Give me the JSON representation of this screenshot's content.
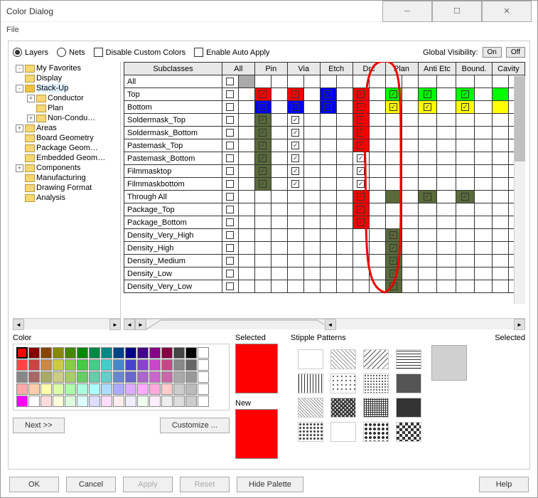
{
  "window": {
    "title": "Color Dialog"
  },
  "menu": {
    "file": "File"
  },
  "top": {
    "layers": "Layers",
    "nets": "Nets",
    "disable_custom": "Disable Custom Colors",
    "enable_auto": "Enable Auto Apply",
    "gv_label": "Global Visibility:",
    "on": "On",
    "off": "Off"
  },
  "tree": [
    {
      "ind": 0,
      "exp": "-",
      "label": "My Favorites"
    },
    {
      "ind": 0,
      "exp": "",
      "label": "Display"
    },
    {
      "ind": 0,
      "exp": "-",
      "label": "Stack-Up",
      "sel": true
    },
    {
      "ind": 1,
      "exp": "+",
      "label": "Conductor"
    },
    {
      "ind": 1,
      "exp": "",
      "label": "Plan"
    },
    {
      "ind": 1,
      "exp": "+",
      "label": "Non-Condu…"
    },
    {
      "ind": 0,
      "exp": "+",
      "label": "Areas"
    },
    {
      "ind": 0,
      "exp": "",
      "label": "Board Geometry"
    },
    {
      "ind": 0,
      "exp": "",
      "label": "Package Geom…"
    },
    {
      "ind": 0,
      "exp": "",
      "label": "Embedded Geom…"
    },
    {
      "ind": 0,
      "exp": "+",
      "label": "Components"
    },
    {
      "ind": 0,
      "exp": "",
      "label": "Manufacturing"
    },
    {
      "ind": 0,
      "exp": "",
      "label": "Drawing Format"
    },
    {
      "ind": 0,
      "exp": "",
      "label": "Analysis"
    }
  ],
  "cols": [
    "All",
    "Pin",
    "Via",
    "Etch",
    "Drc",
    "Plan",
    "Anti Etc",
    "Bound.",
    "Cavity"
  ],
  "subclass_hdr": "Subclasses",
  "rows": [
    {
      "name": "All",
      "cells": [
        [
          "cb",
          ""
        ],
        [
          "",
          "#aaa"
        ],
        [
          "",
          ""
        ],
        [
          "",
          ""
        ],
        [
          "",
          ""
        ],
        [
          "",
          ""
        ],
        [
          "",
          ""
        ],
        [
          "",
          ""
        ],
        [
          "",
          ""
        ],
        [
          "",
          ""
        ],
        [
          "",
          ""
        ],
        [
          "",
          ""
        ],
        [
          "",
          ""
        ],
        [
          "",
          ""
        ],
        [
          "",
          ""
        ],
        [
          "",
          ""
        ],
        [
          "",
          ""
        ],
        [
          "",
          ""
        ]
      ]
    },
    {
      "name": "Top",
      "cells": [
        [
          "cb",
          ""
        ],
        [
          "",
          ""
        ],
        [
          "cbc",
          "#f00"
        ],
        [
          "",
          ""
        ],
        [
          "cbc",
          "#f00"
        ],
        [
          "",
          ""
        ],
        [
          "cbc",
          "#00f"
        ],
        [
          "",
          ""
        ],
        [
          "cbc",
          "#f00"
        ],
        [
          "",
          ""
        ],
        [
          "cbc",
          "#0f0"
        ],
        [
          "",
          ""
        ],
        [
          "cbc",
          "#0f0"
        ],
        [
          "",
          ""
        ],
        [
          "cbc",
          "#0f0"
        ],
        [
          "",
          ""
        ],
        [
          "",
          "#0f0"
        ],
        [
          "",
          ""
        ]
      ]
    },
    {
      "name": "Bottom",
      "cells": [
        [
          "cb",
          ""
        ],
        [
          "",
          ""
        ],
        [
          "cbc",
          "#00f"
        ],
        [
          "",
          ""
        ],
        [
          "cbc",
          "#00f"
        ],
        [
          "",
          ""
        ],
        [
          "cbc",
          "#00f"
        ],
        [
          "",
          ""
        ],
        [
          "cbc",
          "#f00"
        ],
        [
          "",
          ""
        ],
        [
          "cbc",
          "#ff0"
        ],
        [
          "",
          ""
        ],
        [
          "cbc",
          "#ff0"
        ],
        [
          "",
          ""
        ],
        [
          "cbc",
          "#ff0"
        ],
        [
          "",
          ""
        ],
        [
          "",
          "#ff0"
        ],
        [
          "",
          ""
        ]
      ]
    },
    {
      "name": "Soldermask_Top",
      "cells": [
        [
          "cb",
          ""
        ],
        [
          "",
          ""
        ],
        [
          "cbc",
          "#5a6b3b"
        ],
        [
          "",
          ""
        ],
        [
          "cbc",
          ""
        ],
        [
          "",
          ""
        ],
        [
          "",
          ""
        ],
        [
          "",
          ""
        ],
        [
          "cbc",
          "#f00"
        ],
        [
          "",
          ""
        ],
        [
          "",
          ""
        ],
        [
          "",
          ""
        ],
        [
          "",
          ""
        ],
        [
          "",
          ""
        ],
        [
          "",
          ""
        ],
        [
          "",
          ""
        ],
        [
          "",
          ""
        ],
        [
          "",
          ""
        ]
      ]
    },
    {
      "name": "Soldermask_Bottom",
      "cells": [
        [
          "cb",
          ""
        ],
        [
          "",
          ""
        ],
        [
          "cbc",
          "#5a6b3b"
        ],
        [
          "",
          ""
        ],
        [
          "cbc",
          ""
        ],
        [
          "",
          ""
        ],
        [
          "",
          ""
        ],
        [
          "",
          ""
        ],
        [
          "cbc",
          "#f00"
        ],
        [
          "",
          ""
        ],
        [
          "",
          ""
        ],
        [
          "",
          ""
        ],
        [
          "",
          ""
        ],
        [
          "",
          ""
        ],
        [
          "",
          ""
        ],
        [
          "",
          ""
        ],
        [
          "",
          ""
        ],
        [
          "",
          ""
        ]
      ]
    },
    {
      "name": "Pastemask_Top",
      "cells": [
        [
          "cb",
          ""
        ],
        [
          "",
          ""
        ],
        [
          "cbc",
          "#5a6b3b"
        ],
        [
          "",
          ""
        ],
        [
          "cbc",
          ""
        ],
        [
          "",
          ""
        ],
        [
          "",
          ""
        ],
        [
          "",
          ""
        ],
        [
          "cbc",
          "#f00"
        ],
        [
          "",
          ""
        ],
        [
          "",
          ""
        ],
        [
          "",
          ""
        ],
        [
          "",
          ""
        ],
        [
          "",
          ""
        ],
        [
          "",
          ""
        ],
        [
          "",
          ""
        ],
        [
          "",
          ""
        ],
        [
          "",
          ""
        ]
      ]
    },
    {
      "name": "Pastemask_Bottom",
      "cells": [
        [
          "cb",
          ""
        ],
        [
          "",
          ""
        ],
        [
          "cbc",
          "#5a6b3b"
        ],
        [
          "",
          ""
        ],
        [
          "cbc",
          ""
        ],
        [
          "",
          ""
        ],
        [
          "",
          ""
        ],
        [
          "",
          ""
        ],
        [
          "cbc",
          ""
        ],
        [
          "",
          ""
        ],
        [
          "",
          ""
        ],
        [
          "",
          ""
        ],
        [
          "",
          ""
        ],
        [
          "",
          ""
        ],
        [
          "",
          ""
        ],
        [
          "",
          ""
        ],
        [
          "",
          ""
        ],
        [
          "",
          ""
        ]
      ]
    },
    {
      "name": "Filmmasktop",
      "cells": [
        [
          "cb",
          ""
        ],
        [
          "",
          ""
        ],
        [
          "cbc",
          "#5a6b3b"
        ],
        [
          "",
          ""
        ],
        [
          "cbc",
          ""
        ],
        [
          "",
          ""
        ],
        [
          "",
          ""
        ],
        [
          "",
          ""
        ],
        [
          "cbc",
          ""
        ],
        [
          "",
          ""
        ],
        [
          "",
          ""
        ],
        [
          "",
          ""
        ],
        [
          "",
          ""
        ],
        [
          "",
          ""
        ],
        [
          "",
          ""
        ],
        [
          "",
          ""
        ],
        [
          "",
          ""
        ],
        [
          "",
          ""
        ]
      ]
    },
    {
      "name": "Filmmaskbottom",
      "cells": [
        [
          "cb",
          ""
        ],
        [
          "",
          ""
        ],
        [
          "cbc",
          "#5a6b3b"
        ],
        [
          "",
          ""
        ],
        [
          "cbc",
          ""
        ],
        [
          "",
          ""
        ],
        [
          "",
          ""
        ],
        [
          "",
          ""
        ],
        [
          "cbc",
          ""
        ],
        [
          "",
          ""
        ],
        [
          "",
          ""
        ],
        [
          "",
          ""
        ],
        [
          "",
          ""
        ],
        [
          "",
          ""
        ],
        [
          "",
          ""
        ],
        [
          "",
          ""
        ],
        [
          "",
          ""
        ],
        [
          "",
          ""
        ]
      ]
    },
    {
      "name": "Through All",
      "cells": [
        [
          "cb",
          ""
        ],
        [
          "",
          ""
        ],
        [
          "",
          ""
        ],
        [
          "",
          ""
        ],
        [
          "",
          ""
        ],
        [
          "",
          ""
        ],
        [
          "",
          ""
        ],
        [
          "",
          ""
        ],
        [
          "cbc",
          "#f00"
        ],
        [
          "",
          ""
        ],
        [
          "",
          "#5a6b3b"
        ],
        [
          "",
          ""
        ],
        [
          "cbc",
          "#5a6b3b"
        ],
        [
          "",
          ""
        ],
        [
          "cbc",
          "#5a6b3b"
        ],
        [
          "",
          ""
        ],
        [
          "",
          ""
        ],
        [
          "",
          ""
        ]
      ]
    },
    {
      "name": "Package_Top",
      "cells": [
        [
          "cb",
          ""
        ],
        [
          "",
          ""
        ],
        [
          "",
          ""
        ],
        [
          "",
          ""
        ],
        [
          "",
          ""
        ],
        [
          "",
          ""
        ],
        [
          "",
          ""
        ],
        [
          "",
          ""
        ],
        [
          "cbc",
          "#f00"
        ],
        [
          "",
          ""
        ],
        [
          "",
          ""
        ],
        [
          "",
          ""
        ],
        [
          "",
          ""
        ],
        [
          "",
          ""
        ],
        [
          "",
          ""
        ],
        [
          "",
          ""
        ],
        [
          "",
          ""
        ],
        [
          "",
          ""
        ]
      ]
    },
    {
      "name": "Package_Bottom",
      "cells": [
        [
          "cb",
          ""
        ],
        [
          "",
          ""
        ],
        [
          "",
          ""
        ],
        [
          "",
          ""
        ],
        [
          "",
          ""
        ],
        [
          "",
          ""
        ],
        [
          "",
          ""
        ],
        [
          "",
          ""
        ],
        [
          "cbc",
          "#f00"
        ],
        [
          "",
          ""
        ],
        [
          "",
          ""
        ],
        [
          "",
          ""
        ],
        [
          "",
          ""
        ],
        [
          "",
          ""
        ],
        [
          "",
          ""
        ],
        [
          "",
          ""
        ],
        [
          "",
          ""
        ],
        [
          "",
          ""
        ]
      ]
    },
    {
      "name": "Density_Very_High",
      "cells": [
        [
          "cb",
          ""
        ],
        [
          "",
          ""
        ],
        [
          "",
          ""
        ],
        [
          "",
          ""
        ],
        [
          "",
          ""
        ],
        [
          "",
          ""
        ],
        [
          "",
          ""
        ],
        [
          "",
          ""
        ],
        [
          "",
          ""
        ],
        [
          "",
          ""
        ],
        [
          "cbc",
          "#5a6b3b"
        ],
        [
          "",
          ""
        ],
        [
          "",
          ""
        ],
        [
          "",
          ""
        ],
        [
          "",
          ""
        ],
        [
          "",
          ""
        ],
        [
          "",
          ""
        ],
        [
          "",
          ""
        ]
      ]
    },
    {
      "name": "Density_High",
      "cells": [
        [
          "cb",
          ""
        ],
        [
          "",
          ""
        ],
        [
          "",
          ""
        ],
        [
          "",
          ""
        ],
        [
          "",
          ""
        ],
        [
          "",
          ""
        ],
        [
          "",
          ""
        ],
        [
          "",
          ""
        ],
        [
          "",
          ""
        ],
        [
          "",
          ""
        ],
        [
          "cbc",
          "#5a6b3b"
        ],
        [
          "",
          ""
        ],
        [
          "",
          ""
        ],
        [
          "",
          ""
        ],
        [
          "",
          ""
        ],
        [
          "",
          ""
        ],
        [
          "",
          ""
        ],
        [
          "",
          ""
        ]
      ]
    },
    {
      "name": "Density_Medium",
      "cells": [
        [
          "cb",
          ""
        ],
        [
          "",
          ""
        ],
        [
          "",
          ""
        ],
        [
          "",
          ""
        ],
        [
          "",
          ""
        ],
        [
          "",
          ""
        ],
        [
          "",
          ""
        ],
        [
          "",
          ""
        ],
        [
          "",
          ""
        ],
        [
          "",
          ""
        ],
        [
          "cbc",
          "#5a6b3b"
        ],
        [
          "",
          ""
        ],
        [
          "",
          ""
        ],
        [
          "",
          ""
        ],
        [
          "",
          ""
        ],
        [
          "",
          ""
        ],
        [
          "",
          ""
        ],
        [
          "",
          ""
        ]
      ]
    },
    {
      "name": "Density_Low",
      "cells": [
        [
          "cb",
          ""
        ],
        [
          "",
          ""
        ],
        [
          "",
          ""
        ],
        [
          "",
          ""
        ],
        [
          "",
          ""
        ],
        [
          "",
          ""
        ],
        [
          "",
          ""
        ],
        [
          "",
          ""
        ],
        [
          "",
          ""
        ],
        [
          "",
          ""
        ],
        [
          "cbc",
          "#5a6b3b"
        ],
        [
          "",
          ""
        ],
        [
          "",
          ""
        ],
        [
          "",
          ""
        ],
        [
          "",
          ""
        ],
        [
          "",
          ""
        ],
        [
          "",
          ""
        ],
        [
          "",
          ""
        ]
      ]
    },
    {
      "name": "Density_Very_Low",
      "cells": [
        [
          "cb",
          ""
        ],
        [
          "",
          ""
        ],
        [
          "",
          ""
        ],
        [
          "",
          ""
        ],
        [
          "",
          ""
        ],
        [
          "",
          ""
        ],
        [
          "",
          ""
        ],
        [
          "",
          ""
        ],
        [
          "",
          ""
        ],
        [
          "",
          ""
        ],
        [
          "cbc",
          "#5a6b3b"
        ],
        [
          "",
          ""
        ],
        [
          "",
          ""
        ],
        [
          "",
          ""
        ],
        [
          "",
          ""
        ],
        [
          "",
          ""
        ],
        [
          "",
          ""
        ],
        [
          "",
          ""
        ]
      ]
    }
  ],
  "lower": {
    "color": "Color",
    "selected": "Selected",
    "new": "New",
    "stipple": "Stipple Patterns",
    "stip_selected": "Selected",
    "next": "Next >>",
    "customize": "Customize ...",
    "selected_color": "#f00",
    "new_color": "#f00"
  },
  "palette": [
    "#f00",
    "#800",
    "#840",
    "#880",
    "#480",
    "#080",
    "#084",
    "#088",
    "#048",
    "#008",
    "#408",
    "#808",
    "#804",
    "#444",
    "#000",
    "#fff",
    "#f44",
    "#c44",
    "#c84",
    "#cc4",
    "#8c4",
    "#4c4",
    "#4c8",
    "#4cc",
    "#48c",
    "#44c",
    "#84c",
    "#c4c",
    "#c48",
    "#888",
    "#666",
    "#fff",
    "#888",
    "#a66",
    "#aa6",
    "#cc8",
    "#ac6",
    "#6c6",
    "#6ca",
    "#6cc",
    "#68c",
    "#66c",
    "#a6c",
    "#c6c",
    "#c6a",
    "#aaa",
    "#999",
    "#fff",
    "#faa",
    "#fca",
    "#ffa",
    "#dfa",
    "#afa",
    "#afd",
    "#aff",
    "#adf",
    "#aaf",
    "#daf",
    "#faf",
    "#fad",
    "#fcc",
    "#ccc",
    "#bbb",
    "#fff",
    "#f0f",
    "#fff",
    "#fdd",
    "#ffd",
    "#dfd",
    "#dff",
    "#ddf",
    "#fdf",
    "#fee",
    "#eef",
    "#efe",
    "#fef",
    "#eee",
    "#ddd",
    "#ccc",
    "#fff"
  ],
  "buttons": {
    "ok": "OK",
    "cancel": "Cancel",
    "apply": "Apply",
    "reset": "Reset",
    "hide_palette": "Hide Palette",
    "help": "Help"
  }
}
